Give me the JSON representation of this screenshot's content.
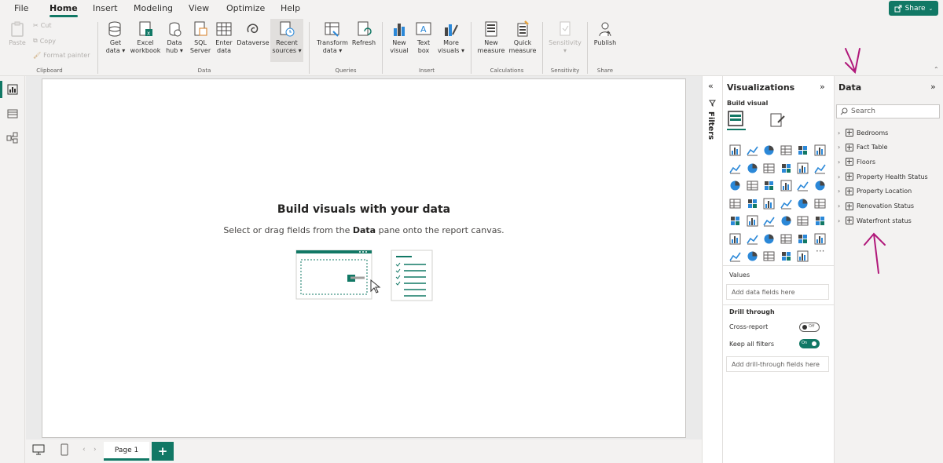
{
  "menu": {
    "items": [
      "File",
      "Home",
      "Insert",
      "Modeling",
      "View",
      "Optimize",
      "Help"
    ],
    "active": "Home",
    "share_label": "Share"
  },
  "ribbon": {
    "clipboard": {
      "paste": "Paste",
      "cut": "Cut",
      "copy": "Copy",
      "format_painter": "Format painter",
      "label": "Clipboard"
    },
    "data": {
      "get_data": [
        "Get",
        "data ▾"
      ],
      "excel": [
        "Excel",
        "workbook"
      ],
      "data_hub": [
        "Data",
        "hub ▾"
      ],
      "sql": [
        "SQL",
        "Server"
      ],
      "enter": [
        "Enter",
        "data"
      ],
      "dataverse": [
        "Dataverse"
      ],
      "recent": [
        "Recent",
        "sources ▾"
      ],
      "label": "Data"
    },
    "queries": {
      "transform": [
        "Transform",
        "data ▾"
      ],
      "refresh": [
        "Refresh"
      ],
      "label": "Queries"
    },
    "insert": {
      "new_visual": [
        "New",
        "visual"
      ],
      "text_box": [
        "Text",
        "box"
      ],
      "more_visuals": [
        "More",
        "visuals ▾"
      ],
      "label": "Insert"
    },
    "calculations": {
      "new_measure": [
        "New",
        "measure"
      ],
      "quick_measure": [
        "Quick",
        "measure"
      ],
      "label": "Calculations"
    },
    "sensitivity": {
      "sensitivity": [
        "Sensitivity",
        "▾"
      ],
      "label": "Sensitivity"
    },
    "share": {
      "publish": [
        "Publish"
      ],
      "label": "Share"
    }
  },
  "canvas": {
    "empty_title": "Build visuals with your data",
    "empty_sub_pre": "Select or drag fields from the ",
    "empty_sub_bold": "Data",
    "empty_sub_post": " pane onto the report canvas."
  },
  "pages": {
    "tab_label": "Page 1",
    "add_label": "+"
  },
  "filters": {
    "label": "Filters"
  },
  "visualizations": {
    "title": "Visualizations",
    "build_visual": "Build visual",
    "values_label": "Values",
    "values_placeholder": "Add data fields here",
    "drill_through": "Drill through",
    "cross_report": "Cross-report",
    "cross_report_state": "Off",
    "keep_all_filters": "Keep all filters",
    "keep_all_filters_state": "On",
    "drill_placeholder": "Add drill-through fields here",
    "more": "···"
  },
  "data_pane": {
    "title": "Data",
    "search_placeholder": "Search",
    "tables": [
      "Bedrooms",
      "Fact Table",
      "Floors",
      "Property Health Status",
      "Property Location",
      "Renovation Status",
      "Waterfront status"
    ]
  },
  "colors": {
    "accent": "#117865",
    "annotation": "#b0187a"
  }
}
